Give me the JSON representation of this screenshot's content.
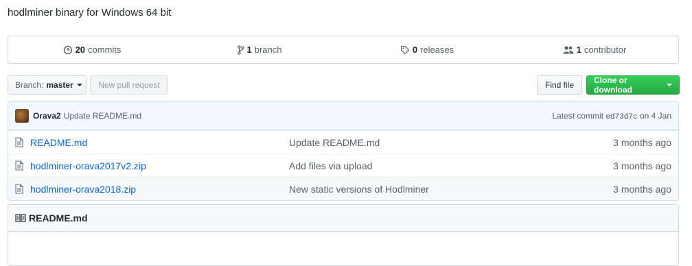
{
  "repo": {
    "description": "hodlminer binary for Windows 64 bit"
  },
  "summary": {
    "commits": {
      "count": "20",
      "label": "commits"
    },
    "branches": {
      "count": "1",
      "label": "branch"
    },
    "releases": {
      "count": "0",
      "label": "releases"
    },
    "contributors": {
      "count": "1",
      "label": "contributor"
    }
  },
  "toolbar": {
    "branch_prefix": "Branch:",
    "branch_name": "master",
    "new_pull_request": "New pull request",
    "find_file": "Find file",
    "clone_download": "Clone or download"
  },
  "commit": {
    "author": "Orava2",
    "message": "Update README.md",
    "latest_label": "Latest commit",
    "sha": "ed73d7c",
    "date": "on 4 Jan"
  },
  "files": [
    {
      "name": "README.md",
      "message": "Update README.md",
      "age": "3 months ago"
    },
    {
      "name": "hodlminer-orava2017v2.zip",
      "message": "Add files via upload",
      "age": "3 months ago"
    },
    {
      "name": "hodlminer-orava2018.zip",
      "message": "New static versions of Hodlminer",
      "age": "3 months ago"
    }
  ],
  "readme": {
    "title": "README.md"
  },
  "colors": {
    "link": "#0366d6",
    "green_button": "#28a745",
    "commit_bar": "#f1f8ff"
  }
}
